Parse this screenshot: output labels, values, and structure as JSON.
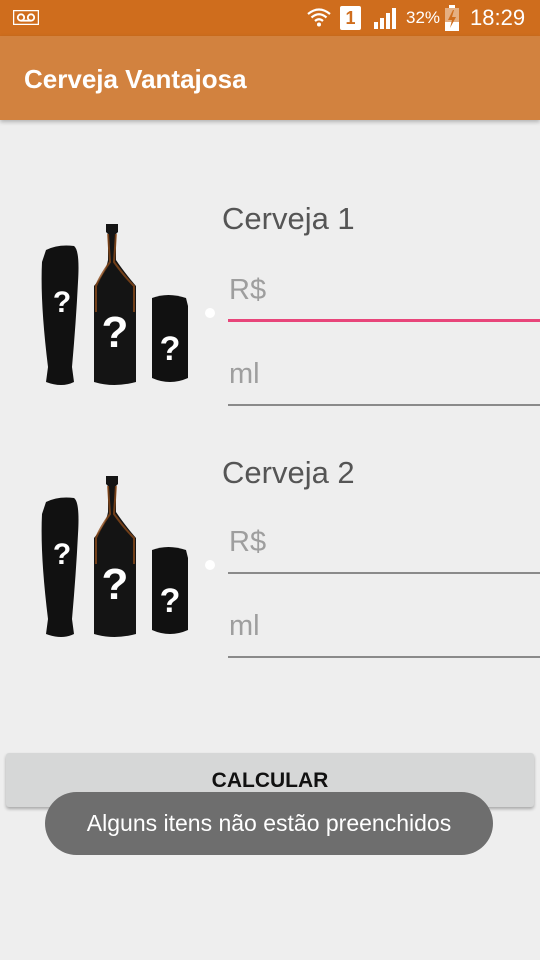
{
  "status_bar": {
    "sim_slot": "1",
    "battery_percent": "32%",
    "time": "18:29",
    "icons": [
      "voicemail-icon",
      "wifi-icon",
      "sim-icon",
      "signal-icon",
      "battery-charging-icon"
    ]
  },
  "app_bar": {
    "title": "Cerveja Vantajosa"
  },
  "beer1": {
    "label": "Cerveja 1",
    "price_placeholder": "R$",
    "volume_placeholder": "ml",
    "image_icon": "beer-unknown-icon"
  },
  "beer2": {
    "label": "Cerveja 2",
    "price_placeholder": "R$",
    "volume_placeholder": "ml",
    "image_icon": "beer-unknown-icon"
  },
  "calculate_button": {
    "label": "CALCULAR"
  },
  "toast": {
    "message": "Alguns itens não estão preenchidos"
  },
  "colors": {
    "status_bar": "#cf6d1d",
    "app_bar": "#d2823f",
    "focus_underline": "#e8457a",
    "background": "#eeeeee"
  }
}
